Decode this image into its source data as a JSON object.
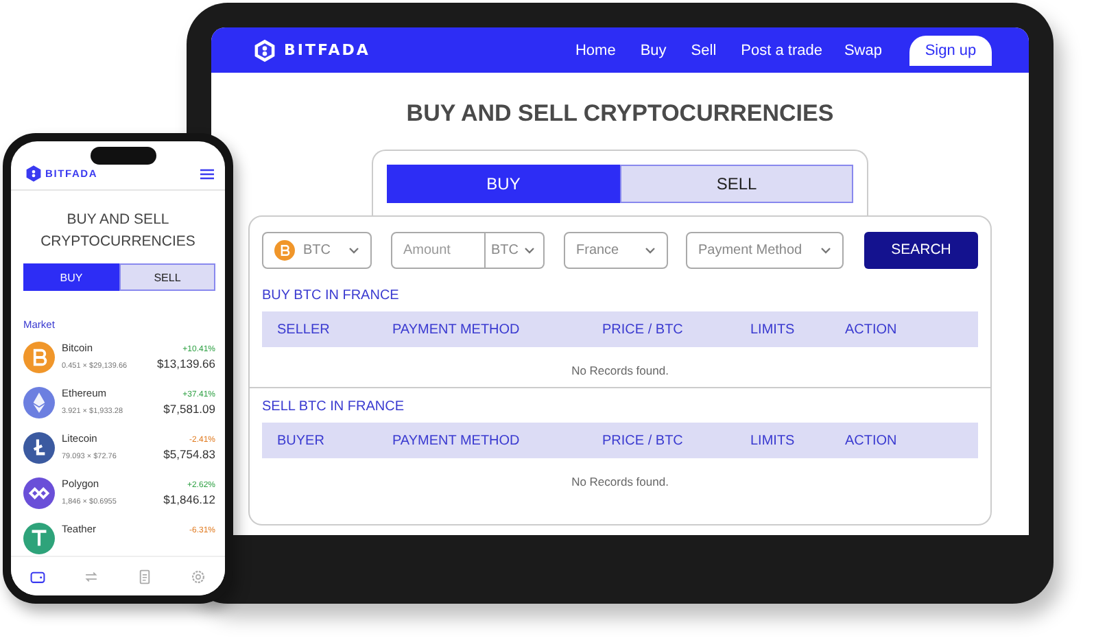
{
  "tablet": {
    "nav": {
      "logo": "BITFADA",
      "links": [
        "Home",
        "Buy",
        "Sell",
        "Post a trade",
        "Swap"
      ],
      "signup": "Sign up"
    },
    "title": "BUY AND SELL CRYPTOCURRENCIES",
    "tabs": [
      {
        "label": "BUY",
        "selected": true
      },
      {
        "label": "SELL",
        "selected": false
      }
    ],
    "filters": {
      "coin": "BTC",
      "amount_placeholder": "Amount",
      "amount_unit": "BTC",
      "country": "France",
      "payment_placeholder": "Payment Method",
      "search": "SEARCH"
    },
    "sections": [
      {
        "heading": "BUY BTC IN FRANCE",
        "columns": [
          "SELLER",
          "PAYMENT METHOD",
          "PRICE / BTC",
          "LIMITS",
          "ACTION"
        ],
        "empty": "No Records found."
      },
      {
        "heading": "SELL BTC IN FRANCE",
        "columns": [
          "BUYER",
          "PAYMENT METHOD",
          "PRICE / BTC",
          "LIMITS",
          "ACTION"
        ],
        "empty": "No Records found."
      }
    ]
  },
  "phone": {
    "logo": "BITFADA",
    "title": "BUY AND SELL CRYPTOCURRENCIES",
    "tabs": [
      {
        "label": "BUY",
        "selected": true
      },
      {
        "label": "SELL",
        "selected": false
      }
    ],
    "market_label": "Market",
    "coins": [
      {
        "kind": "bitcoin",
        "color": "#f0962a",
        "name": "Bitcoin",
        "detail": "0.451 × $29,139.66",
        "change": {
          "text": "+10.41%",
          "color": "#2ea043"
        },
        "value": "$13,139.66"
      },
      {
        "kind": "ethereum",
        "color": "#6c7fe0",
        "name": "Ethereum",
        "detail": "3.921 × $1,933.28",
        "change": {
          "text": "+37.41%",
          "color": "#2ea043"
        },
        "value": "$7,581.09"
      },
      {
        "kind": "litecoin",
        "color": "#3b5aa0",
        "name": "Litecoin",
        "detail": "79.093 × $72.76",
        "change": {
          "text": "-2.41%",
          "color": "#e07a1f"
        },
        "value": "$5,754.83"
      },
      {
        "kind": "polygon",
        "color": "#6a4fd8",
        "name": "Polygon",
        "detail": "1,846 × $0.6955",
        "change": {
          "text": "+2.62%",
          "color": "#2ea043"
        },
        "value": "$1,846.12"
      },
      {
        "kind": "tether",
        "color": "#2ea37a",
        "name": "Teather",
        "change": {
          "text": "-6.31%",
          "color": "#e07a1f"
        }
      }
    ],
    "nav": [
      {
        "kind": "wallet",
        "selected": true
      },
      {
        "kind": "swap",
        "selected": false
      },
      {
        "kind": "document",
        "selected": false
      },
      {
        "kind": "settings",
        "selected": false
      }
    ]
  }
}
